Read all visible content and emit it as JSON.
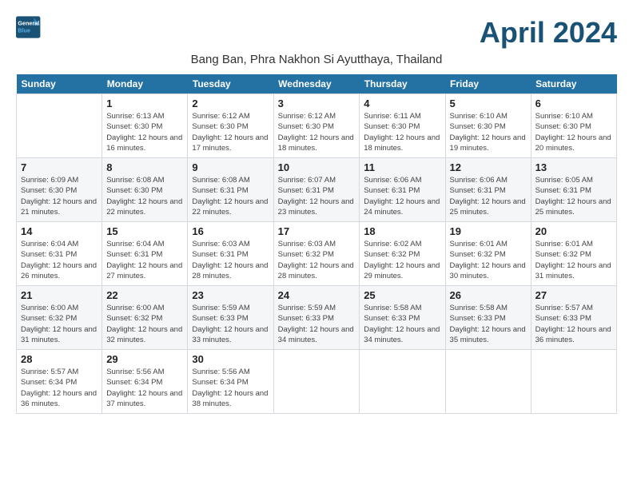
{
  "header": {
    "logo_line1": "General",
    "logo_line2": "Blue",
    "month_year": "April 2024",
    "location": "Bang Ban, Phra Nakhon Si Ayutthaya, Thailand"
  },
  "weekdays": [
    "Sunday",
    "Monday",
    "Tuesday",
    "Wednesday",
    "Thursday",
    "Friday",
    "Saturday"
  ],
  "weeks": [
    [
      {
        "day": "",
        "sunrise": "",
        "sunset": "",
        "daylight": ""
      },
      {
        "day": "1",
        "sunrise": "Sunrise: 6:13 AM",
        "sunset": "Sunset: 6:30 PM",
        "daylight": "Daylight: 12 hours and 16 minutes."
      },
      {
        "day": "2",
        "sunrise": "Sunrise: 6:12 AM",
        "sunset": "Sunset: 6:30 PM",
        "daylight": "Daylight: 12 hours and 17 minutes."
      },
      {
        "day": "3",
        "sunrise": "Sunrise: 6:12 AM",
        "sunset": "Sunset: 6:30 PM",
        "daylight": "Daylight: 12 hours and 18 minutes."
      },
      {
        "day": "4",
        "sunrise": "Sunrise: 6:11 AM",
        "sunset": "Sunset: 6:30 PM",
        "daylight": "Daylight: 12 hours and 18 minutes."
      },
      {
        "day": "5",
        "sunrise": "Sunrise: 6:10 AM",
        "sunset": "Sunset: 6:30 PM",
        "daylight": "Daylight: 12 hours and 19 minutes."
      },
      {
        "day": "6",
        "sunrise": "Sunrise: 6:10 AM",
        "sunset": "Sunset: 6:30 PM",
        "daylight": "Daylight: 12 hours and 20 minutes."
      }
    ],
    [
      {
        "day": "7",
        "sunrise": "Sunrise: 6:09 AM",
        "sunset": "Sunset: 6:30 PM",
        "daylight": "Daylight: 12 hours and 21 minutes."
      },
      {
        "day": "8",
        "sunrise": "Sunrise: 6:08 AM",
        "sunset": "Sunset: 6:30 PM",
        "daylight": "Daylight: 12 hours and 22 minutes."
      },
      {
        "day": "9",
        "sunrise": "Sunrise: 6:08 AM",
        "sunset": "Sunset: 6:31 PM",
        "daylight": "Daylight: 12 hours and 22 minutes."
      },
      {
        "day": "10",
        "sunrise": "Sunrise: 6:07 AM",
        "sunset": "Sunset: 6:31 PM",
        "daylight": "Daylight: 12 hours and 23 minutes."
      },
      {
        "day": "11",
        "sunrise": "Sunrise: 6:06 AM",
        "sunset": "Sunset: 6:31 PM",
        "daylight": "Daylight: 12 hours and 24 minutes."
      },
      {
        "day": "12",
        "sunrise": "Sunrise: 6:06 AM",
        "sunset": "Sunset: 6:31 PM",
        "daylight": "Daylight: 12 hours and 25 minutes."
      },
      {
        "day": "13",
        "sunrise": "Sunrise: 6:05 AM",
        "sunset": "Sunset: 6:31 PM",
        "daylight": "Daylight: 12 hours and 25 minutes."
      }
    ],
    [
      {
        "day": "14",
        "sunrise": "Sunrise: 6:04 AM",
        "sunset": "Sunset: 6:31 PM",
        "daylight": "Daylight: 12 hours and 26 minutes."
      },
      {
        "day": "15",
        "sunrise": "Sunrise: 6:04 AM",
        "sunset": "Sunset: 6:31 PM",
        "daylight": "Daylight: 12 hours and 27 minutes."
      },
      {
        "day": "16",
        "sunrise": "Sunrise: 6:03 AM",
        "sunset": "Sunset: 6:31 PM",
        "daylight": "Daylight: 12 hours and 28 minutes."
      },
      {
        "day": "17",
        "sunrise": "Sunrise: 6:03 AM",
        "sunset": "Sunset: 6:32 PM",
        "daylight": "Daylight: 12 hours and 28 minutes."
      },
      {
        "day": "18",
        "sunrise": "Sunrise: 6:02 AM",
        "sunset": "Sunset: 6:32 PM",
        "daylight": "Daylight: 12 hours and 29 minutes."
      },
      {
        "day": "19",
        "sunrise": "Sunrise: 6:01 AM",
        "sunset": "Sunset: 6:32 PM",
        "daylight": "Daylight: 12 hours and 30 minutes."
      },
      {
        "day": "20",
        "sunrise": "Sunrise: 6:01 AM",
        "sunset": "Sunset: 6:32 PM",
        "daylight": "Daylight: 12 hours and 31 minutes."
      }
    ],
    [
      {
        "day": "21",
        "sunrise": "Sunrise: 6:00 AM",
        "sunset": "Sunset: 6:32 PM",
        "daylight": "Daylight: 12 hours and 31 minutes."
      },
      {
        "day": "22",
        "sunrise": "Sunrise: 6:00 AM",
        "sunset": "Sunset: 6:32 PM",
        "daylight": "Daylight: 12 hours and 32 minutes."
      },
      {
        "day": "23",
        "sunrise": "Sunrise: 5:59 AM",
        "sunset": "Sunset: 6:33 PM",
        "daylight": "Daylight: 12 hours and 33 minutes."
      },
      {
        "day": "24",
        "sunrise": "Sunrise: 5:59 AM",
        "sunset": "Sunset: 6:33 PM",
        "daylight": "Daylight: 12 hours and 34 minutes."
      },
      {
        "day": "25",
        "sunrise": "Sunrise: 5:58 AM",
        "sunset": "Sunset: 6:33 PM",
        "daylight": "Daylight: 12 hours and 34 minutes."
      },
      {
        "day": "26",
        "sunrise": "Sunrise: 5:58 AM",
        "sunset": "Sunset: 6:33 PM",
        "daylight": "Daylight: 12 hours and 35 minutes."
      },
      {
        "day": "27",
        "sunrise": "Sunrise: 5:57 AM",
        "sunset": "Sunset: 6:33 PM",
        "daylight": "Daylight: 12 hours and 36 minutes."
      }
    ],
    [
      {
        "day": "28",
        "sunrise": "Sunrise: 5:57 AM",
        "sunset": "Sunset: 6:34 PM",
        "daylight": "Daylight: 12 hours and 36 minutes."
      },
      {
        "day": "29",
        "sunrise": "Sunrise: 5:56 AM",
        "sunset": "Sunset: 6:34 PM",
        "daylight": "Daylight: 12 hours and 37 minutes."
      },
      {
        "day": "30",
        "sunrise": "Sunrise: 5:56 AM",
        "sunset": "Sunset: 6:34 PM",
        "daylight": "Daylight: 12 hours and 38 minutes."
      },
      {
        "day": "",
        "sunrise": "",
        "sunset": "",
        "daylight": ""
      },
      {
        "day": "",
        "sunrise": "",
        "sunset": "",
        "daylight": ""
      },
      {
        "day": "",
        "sunrise": "",
        "sunset": "",
        "daylight": ""
      },
      {
        "day": "",
        "sunrise": "",
        "sunset": "",
        "daylight": ""
      }
    ]
  ]
}
